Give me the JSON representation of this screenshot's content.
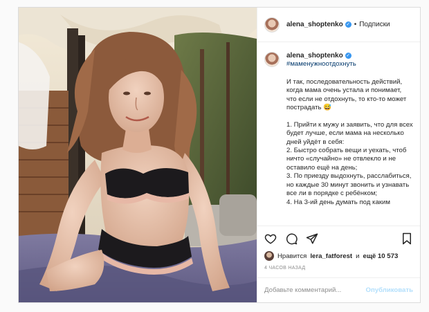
{
  "post": {
    "username": "alena_shoptenko",
    "verified_mark": "✓",
    "separator": "•",
    "follow_label": "Подписки",
    "hashtag": "#маменужноотдохнуть",
    "caption": "И так, последовательность действий, когда мама очень устала и понимает, что если не отдохнуть, то кто-то может пострадать 😅\n\n1. Прийти к мужу и заявить, что для всех будет лучше, если мама на несколько дней уйдёт в себя:\n2. Быстро собрать вещи и уехать, чтоб ничто «случайно» не отвлекло и не оставило ещё на день;\n3. По приезду выдохнуть, расслабиться, но каждые 30 минут звонить и узнавать все ли в порядке с ребёнком;\n4. На 3-ий день думать под каким",
    "likes": {
      "prefix": "Нравится",
      "user": "lera_fatforest",
      "middle": "и",
      "count": "ещё 10 573"
    },
    "time_ago": "4 ЧАСОВ НАЗАД",
    "comment_placeholder": "Добавьте комментарий...",
    "publish_label": "Опубликовать"
  },
  "icons": {
    "like": "heart-icon",
    "comment": "comment-icon",
    "share": "share-icon",
    "save": "bookmark-icon"
  },
  "colors": {
    "link": "#00376b",
    "verified": "#3897f0",
    "publish_disabled": "#b2dffc",
    "muted": "#8e8e8e"
  }
}
